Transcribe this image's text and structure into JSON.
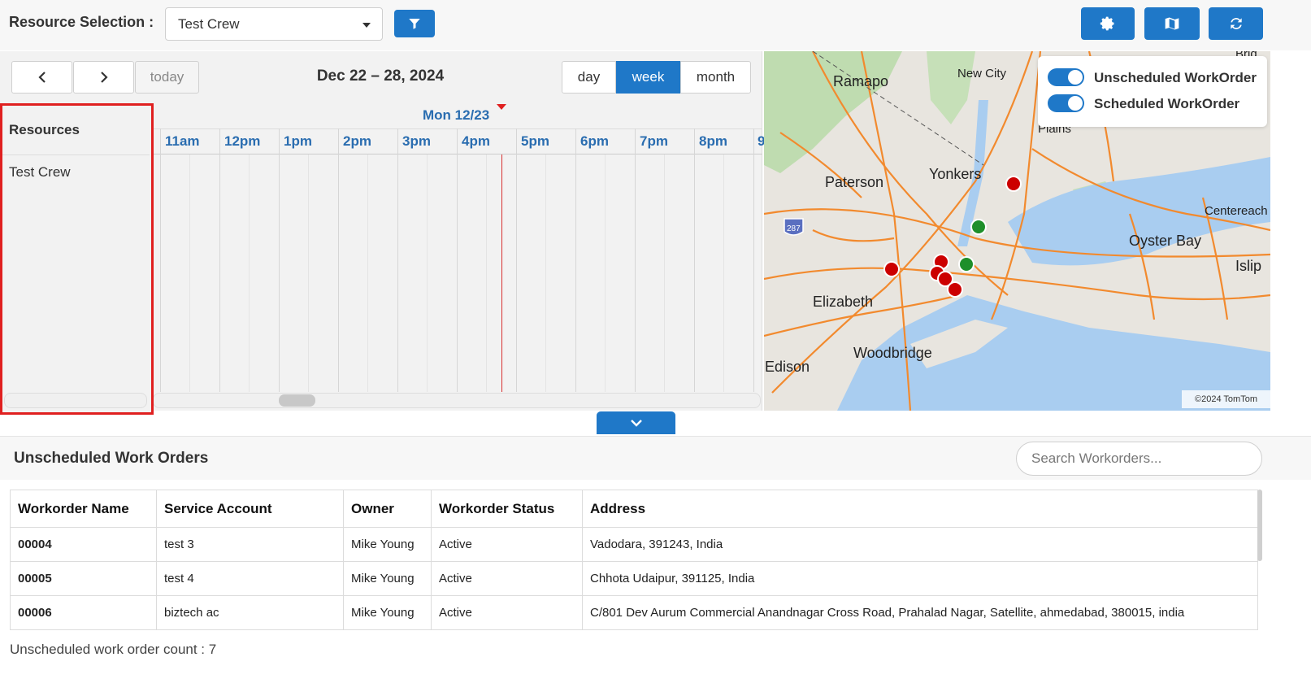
{
  "toolbar": {
    "resource_label": "Resource Selection :",
    "resource_value": "Test Crew",
    "icons": [
      "filter-icon",
      "gear-icon",
      "map-icon",
      "refresh-icon"
    ]
  },
  "calendar": {
    "range_title": "Dec 22 – 28, 2024",
    "today_label": "today",
    "views": [
      "day",
      "week",
      "month"
    ],
    "active_view": "week",
    "day_header": "Mon 12/23",
    "hours": [
      "11am",
      "12pm",
      "1pm",
      "2pm",
      "3pm",
      "4pm",
      "5pm",
      "6pm",
      "7pm",
      "8pm",
      "9"
    ],
    "resources_header": "Resources",
    "resources": [
      "Test Crew"
    ]
  },
  "map": {
    "legend": [
      "Unscheduled WorkOrder",
      "Scheduled WorkOrder"
    ],
    "places": [
      "Ramapo",
      "New City",
      "Plains",
      "Paterson",
      "Yonkers",
      "Centereach",
      "Oyster Bay",
      "Islip",
      "Elizabeth",
      "Woodbridge",
      "Edison",
      "287",
      "Brid"
    ],
    "copyright": "©2024 TomTom",
    "colors": {
      "unscheduled": "#cc0000",
      "scheduled": "#1e8f2a"
    }
  },
  "unscheduled": {
    "title": "Unscheduled Work Orders",
    "search_placeholder": "Search Workorders...",
    "columns": [
      "Workorder Name",
      "Service Account",
      "Owner",
      "Workorder Status",
      "Address"
    ],
    "rows": [
      [
        "00004",
        "test 3",
        "Mike Young",
        "Active",
        "Vadodara, 391243, India"
      ],
      [
        "00005",
        "test 4",
        "Mike Young",
        "Active",
        "Chhota Udaipur, 391125, India"
      ],
      [
        "00006",
        "biztech ac",
        "Mike Young",
        "Active",
        "C/801 Dev Aurum Commercial Anandnagar Cross Road, Prahalad Nagar, Satellite, ahmedabad, 380015, india"
      ]
    ],
    "count_text": "Unscheduled work order count : 7"
  },
  "accent": "#1f78c8"
}
